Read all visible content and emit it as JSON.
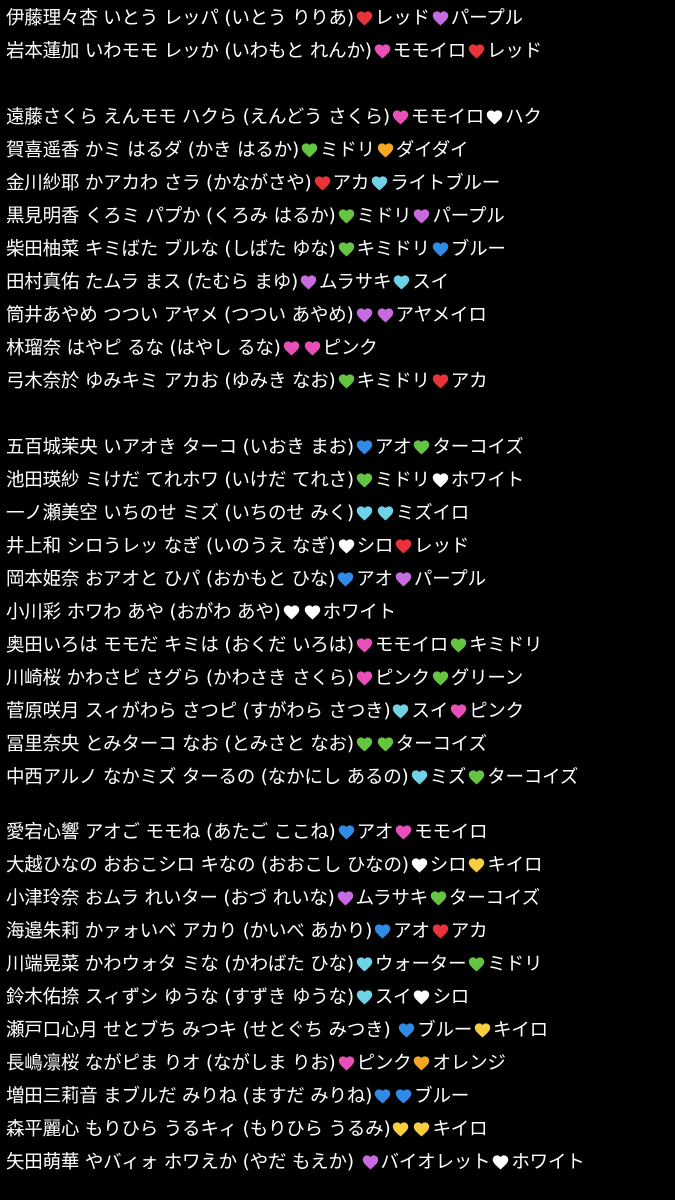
{
  "colors": {
    "background": "#000000",
    "text": "#ffffff",
    "red": "#e8333b",
    "purple": "#c86be0",
    "pink": "#e94fb8",
    "white": "#ffffff",
    "green": "#63c542",
    "yellow": "#f6cf3f",
    "orange": "#f5a623",
    "blue": "#2f8be6",
    "lightblue": "#6fd3e8"
  },
  "groups": [
    {
      "lines": [
        {
          "text": "伊藤理々杏 いとう レッパ (いとう りりあ)",
          "hearts": [
            "red"
          ],
          "after1": "レッド",
          "hearts2": [
            "purple"
          ],
          "after2": "パープル"
        },
        {
          "text": "岩本蓮加 いわモモ レッか (いわもと れんか)",
          "hearts": [
            "pink"
          ],
          "after1": "モモイロ",
          "hearts2": [
            "red"
          ],
          "after2": "レッド"
        }
      ]
    },
    {
      "lines": [
        {
          "text": "遠藤さくら えんモモ ハクら (えんどう さくら)",
          "hearts": [
            "pink"
          ],
          "after1": "モモイロ",
          "hearts2": [
            "white"
          ],
          "after2": "ハク"
        },
        {
          "text": "賀喜遥香  かミ はるダ (かき はるか)",
          "hearts": [
            "green"
          ],
          "after1": "ミドリ",
          "hearts2": [
            "orange"
          ],
          "after2": "ダイダイ"
        },
        {
          "text": "金川紗耶 かアカわ さラ (かながさや)",
          "hearts": [
            "red"
          ],
          "after1": "アカ",
          "hearts2": [
            "lightblue"
          ],
          "after2": "ライトブルー"
        },
        {
          "text": "黒見明香 くろミ パプか (くろみ はるか)",
          "hearts": [
            "green"
          ],
          "after1": "ミドリ",
          "hearts2": [
            "purple"
          ],
          "after2": "パープル"
        },
        {
          "text": "柴田柚菜 キミばた ブルな (しばた ゆな)",
          "hearts": [
            "green"
          ],
          "after1": "キミドリ",
          "hearts2": [
            "blue"
          ],
          "after2": "ブルー"
        },
        {
          "text": "田村真佑 たムラ まス (たむら まゆ)",
          "hearts": [
            "purple"
          ],
          "after1": "ムラサキ",
          "hearts2": [
            "lightblue"
          ],
          "after2": "スイ"
        },
        {
          "text": "筒井あやめ つつい アヤメ (つつい あやめ)",
          "hearts": [
            "purple",
            "purple"
          ],
          "after1": "",
          "hearts2": [],
          "after2": "アヤメイロ"
        },
        {
          "text": "林瑠奈 はやピ るな (はやし るな)",
          "hearts": [
            "pink",
            "pink"
          ],
          "after1": "",
          "hearts2": [],
          "after2": "ピンク"
        },
        {
          "text": "弓木奈於 ゆみキミ アカお (ゆみき なお)",
          "hearts": [
            "green"
          ],
          "after1": "キミドリ",
          "hearts2": [
            "red"
          ],
          "after2": "アカ"
        }
      ]
    },
    {
      "lines": [
        {
          "text": "五百城茉央 いアオき ターコ (いおき まお)",
          "hearts": [
            "blue"
          ],
          "after1": "アオ",
          "hearts2": [
            "green"
          ],
          "after2": "ターコイズ"
        },
        {
          "text": "池田瑛紗 ミけだ てれホワ (いけだ てれさ)",
          "hearts": [
            "green"
          ],
          "after1": "ミドリ",
          "hearts2": [
            "white"
          ],
          "after2": "ホワイト"
        },
        {
          "text": "一ノ瀬美空 いちのせ ミズ (いちのせ みく)",
          "hearts": [
            "lightblue",
            "lightblue"
          ],
          "after1": "",
          "hearts2": [],
          "after2": "ミズイロ"
        },
        {
          "text": "井上和 シロうレッ なぎ (いのうえ なぎ)",
          "hearts": [
            "white"
          ],
          "after1": "シロ",
          "hearts2": [
            "red"
          ],
          "after2": "レッド"
        },
        {
          "text": "岡本姫奈 おアオと ひパ (おかもと ひな)",
          "hearts": [
            "blue"
          ],
          "after1": "アオ",
          "hearts2": [
            "purple"
          ],
          "after2": "パープル"
        },
        {
          "text": "小川彩 ホワわ あや (おがわ あや)",
          "hearts": [
            "white",
            "white"
          ],
          "after1": "",
          "hearts2": [],
          "after2": "ホワイト"
        },
        {
          "text": "奥田いろは モモだ キミは (おくだ いろは)",
          "hearts": [
            "pink"
          ],
          "after1": "モモイロ",
          "hearts2": [
            "green"
          ],
          "after2": "キミドリ"
        },
        {
          "text": "川崎桜 かわさピ さグら (かわさき さくら)",
          "hearts": [
            "pink"
          ],
          "after1": "ピンク",
          "hearts2": [
            "green"
          ],
          "after2": "グリーン"
        },
        {
          "text": "菅原咲月 スィがわら さつピ (すがわら さつき)",
          "hearts": [
            "lightblue"
          ],
          "after1": "スイ",
          "hearts2": [
            "pink"
          ],
          "after2": "ピンク"
        },
        {
          "text": "冨里奈央 とみターコ なお (とみさと なお)",
          "hearts": [
            "green",
            "green"
          ],
          "after1": "",
          "hearts2": [],
          "after2": "ターコイズ"
        },
        {
          "text": "中西アルノ なかミズ ターるの (なかにし あるの)",
          "hearts": [
            "lightblue"
          ],
          "after1": "ミズ",
          "hearts2": [
            "green"
          ],
          "after2": "ターコイズ"
        }
      ]
    },
    {
      "lines": [
        {
          "text": "愛宕心響 アオご モモね (あたご ここね)",
          "hearts": [
            "blue"
          ],
          "after1": "アオ",
          "hearts2": [
            "pink"
          ],
          "after2": "モモイロ"
        },
        {
          "text": "大越ひなの おおこシロ キなの (おおこし ひなの)",
          "hearts": [
            "white"
          ],
          "after1": "シロ",
          "hearts2": [
            "yellow"
          ],
          "after2": "キイロ"
        },
        {
          "text": "小津玲奈 おムラ れいター (おづ れいな)",
          "hearts": [
            "purple"
          ],
          "after1": "ムラサキ",
          "hearts2": [
            "green"
          ],
          "after2": "ターコイズ"
        },
        {
          "text": "海邉朱莉 かァォいベ アカり (かいべ あかり)",
          "hearts": [
            "blue"
          ],
          "after1": "アオ",
          "hearts2": [
            "red"
          ],
          "after2": "アカ"
        },
        {
          "text": "川端晃菜 かわウォタ ミな (かわばた ひな)",
          "hearts": [
            "lightblue"
          ],
          "after1": "ウォーター",
          "hearts2": [
            "green"
          ],
          "after2": "ミドリ"
        },
        {
          "text": "鈴木佑捺 スィずシ ゆうな (すずき ゆうな)",
          "hearts": [
            "lightblue"
          ],
          "after1": "スイ",
          "hearts2": [
            "white"
          ],
          "after2": "シロ"
        },
        {
          "text": "瀬戸口心月 せとブち みつキ (せとぐち みつき) ",
          "hearts": [
            "blue"
          ],
          "after1": "ブルー",
          "hearts2": [
            "yellow"
          ],
          "after2": "キイロ"
        },
        {
          "text": "長嶋凛桜 ながピま りオ (ながしま りお)",
          "hearts": [
            "pink"
          ],
          "after1": "ピンク",
          "hearts2": [
            "orange"
          ],
          "after2": "オレンジ"
        },
        {
          "text": "増田三莉音 まブルだ みりね (ますだ みりね)",
          "hearts": [
            "blue",
            "blue"
          ],
          "after1": "",
          "hearts2": [],
          "after2": "ブルー"
        },
        {
          "text": "森平麗心 もりひら うるキィ (もりひら うるみ)",
          "hearts": [
            "yellow",
            "yellow"
          ],
          "after1": "",
          "hearts2": [],
          "after2": "キイロ"
        },
        {
          "text": "矢田萌華 やバィォ ホワえか (やだ もえか) ",
          "hearts": [
            "purple"
          ],
          "after1": "バイオレット",
          "hearts2": [
            "white"
          ],
          "after2": "ホワイト"
        }
      ]
    }
  ]
}
